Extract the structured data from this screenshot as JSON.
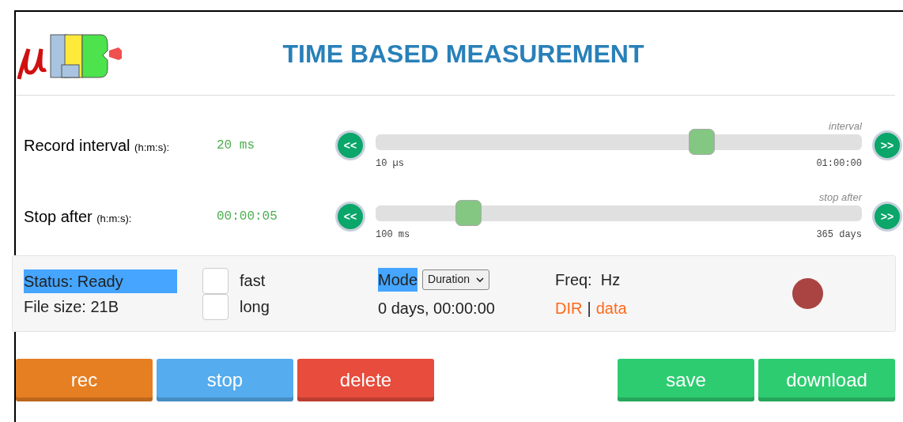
{
  "header": {
    "title": "TIME BASED MEASUREMENT"
  },
  "sliders": [
    {
      "label": "Record interval",
      "unit": "(h:m:s):",
      "value": "20 ms",
      "caption": "interval",
      "min": "10 µs",
      "max": "01:00:00",
      "level": 0.67,
      "prev": "<<",
      "next": ">>"
    },
    {
      "label": "Stop after",
      "unit": "(h:m:s):",
      "value": "00:00:05",
      "caption": "stop after",
      "min": "100 ms",
      "max": "365 days",
      "level": 0.19,
      "prev": "<<",
      "next": ">>"
    }
  ],
  "status": {
    "text": "Status: Ready",
    "highlighted": true,
    "file_size": "File size: 21B"
  },
  "options": [
    {
      "label": "fast",
      "checked": false
    },
    {
      "label": "long",
      "checked": false
    }
  ],
  "mode": {
    "label": "Mode",
    "highlighted": true,
    "value": "Duration",
    "elapsed": "0 days, 00:00:00"
  },
  "freq": "Freq:  Hz",
  "links": [
    {
      "label": "DIR"
    },
    {
      "label": "data"
    }
  ],
  "link_separator": "|",
  "indicator": {
    "color": "#a94442"
  },
  "left_buttons": [
    {
      "label": "rec",
      "color": "#e67e22"
    },
    {
      "label": "stop",
      "color": "#55acee"
    },
    {
      "label": "delete",
      "color": "#e74c3c"
    }
  ],
  "right_buttons": [
    {
      "label": "save",
      "color": "#2ecc71"
    },
    {
      "label": "download",
      "color": "#2ecc71"
    }
  ]
}
